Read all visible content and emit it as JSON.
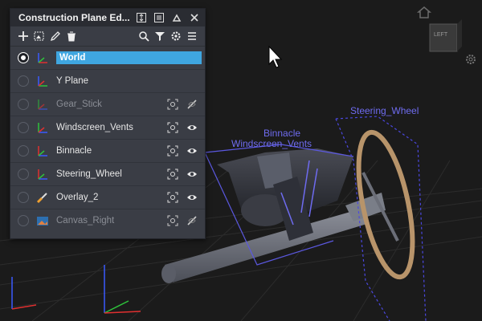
{
  "panel": {
    "title": "Construction Plane Ed...",
    "rows": [
      {
        "label": "World"
      },
      {
        "label": "Y Plane"
      },
      {
        "label": "Gear_Stick"
      },
      {
        "label": "Windscreen_Vents"
      },
      {
        "label": "Binnacle"
      },
      {
        "label": "Steering_Wheel"
      },
      {
        "label": "Overlay_2"
      },
      {
        "label": "Canvas_Right"
      }
    ]
  },
  "viewport": {
    "labels": {
      "steering_wheel": "Steering_Wheel",
      "binnacle": "Binnacle",
      "windscreen_vents": "Windscreen_Vents"
    },
    "view_cube_face": "LEFT"
  },
  "colors": {
    "accent": "#3fa6e0",
    "label_blue": "#6f6cf0",
    "panel_bg": "#3a3d45"
  }
}
